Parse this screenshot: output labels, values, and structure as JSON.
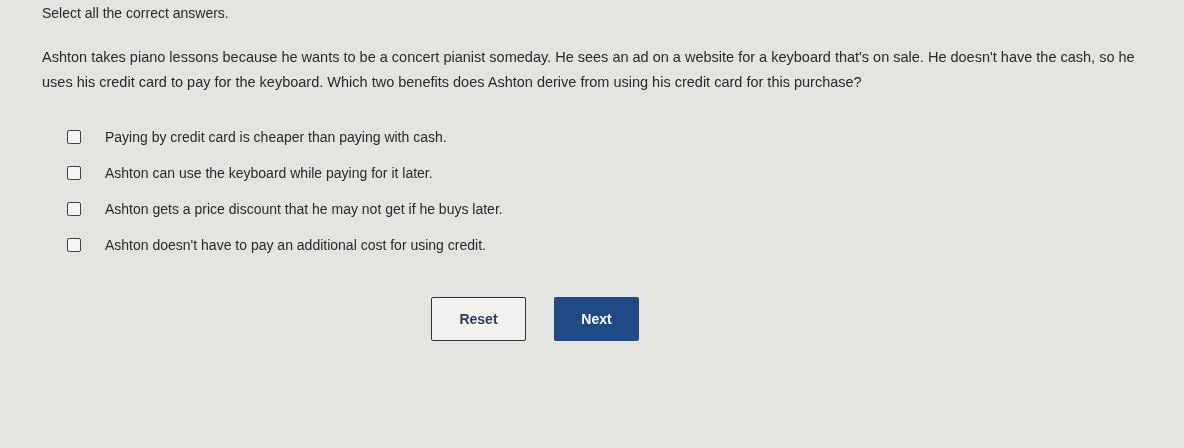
{
  "instruction": "Select all the correct answers.",
  "question": "Ashton takes piano lessons because he wants to be a concert pianist someday. He sees an ad on a website for a keyboard that's on sale. He doesn't have the cash, so he uses his credit card to pay for the keyboard. Which two benefits does Ashton derive from using his credit card for this purchase?",
  "options": [
    {
      "label": "Paying by credit card is cheaper than paying with cash.",
      "checked": false
    },
    {
      "label": "Ashton can use the keyboard while paying for it later.",
      "checked": false
    },
    {
      "label": "Ashton gets a price discount that he may not get if he buys later.",
      "checked": false
    },
    {
      "label": "Ashton doesn't have to pay an additional cost for using credit.",
      "checked": false
    }
  ],
  "buttons": [
    {
      "label": "Reset",
      "kind": "secondary"
    },
    {
      "label": "Next",
      "kind": "primary"
    }
  ]
}
